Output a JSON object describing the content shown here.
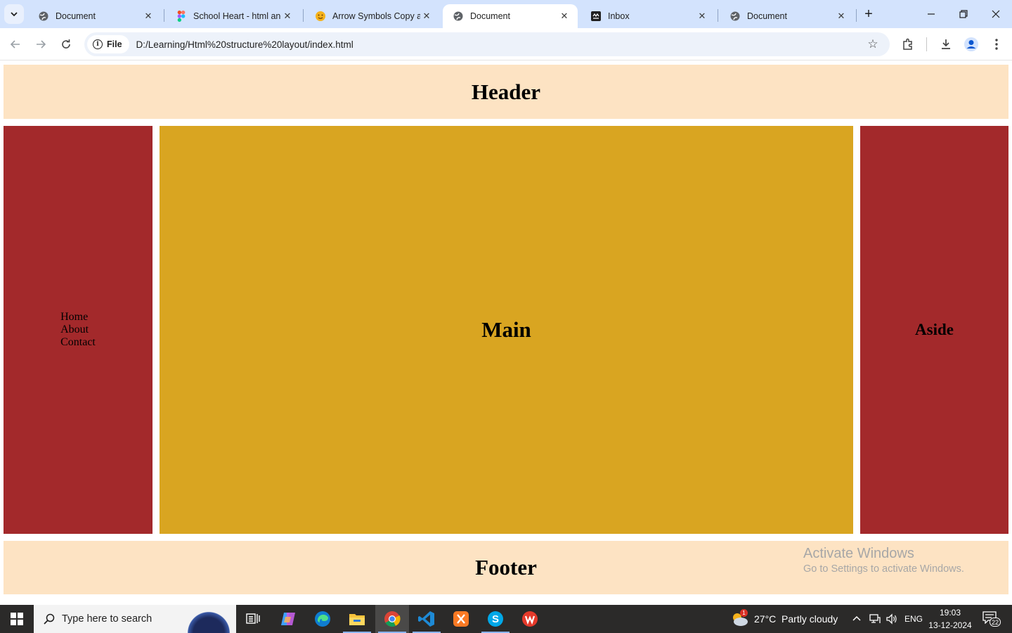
{
  "browser": {
    "tabs": [
      {
        "title": "Document",
        "icon": "globe-icon",
        "active": false
      },
      {
        "title": "School Heart - html and",
        "icon": "figma-icon",
        "active": false
      },
      {
        "title": "Arrow Symbols Copy an",
        "icon": "emoji-icon",
        "active": false
      },
      {
        "title": "Document",
        "icon": "globe-icon",
        "active": true
      },
      {
        "title": "Inbox",
        "icon": "inbox-icon",
        "active": false
      },
      {
        "title": "Document",
        "icon": "globe-icon",
        "active": false
      }
    ],
    "address": {
      "chip_label": "File",
      "url": "D:/Learning/Html%20structure%20layout/index.html"
    }
  },
  "page": {
    "header": "Header",
    "nav_items": [
      "Home",
      "About",
      "Contact"
    ],
    "main": "Main",
    "aside": "Aside",
    "footer": "Footer",
    "colors": {
      "header_bg": "#fde3c3",
      "nav_bg": "#a3292b",
      "main_bg": "#d9a521",
      "aside_bg": "#a3292b",
      "footer_bg": "#fde3c3"
    }
  },
  "watermark": {
    "line1": "Activate Windows",
    "line2": "Go to Settings to activate Windows."
  },
  "taskbar": {
    "search_placeholder": "Type here to search",
    "weather": "27°C  Partly cloudy",
    "weather_badge": "1",
    "language": "ENG",
    "time": "19:03",
    "date": "13-12-2024",
    "notifications": "22"
  }
}
